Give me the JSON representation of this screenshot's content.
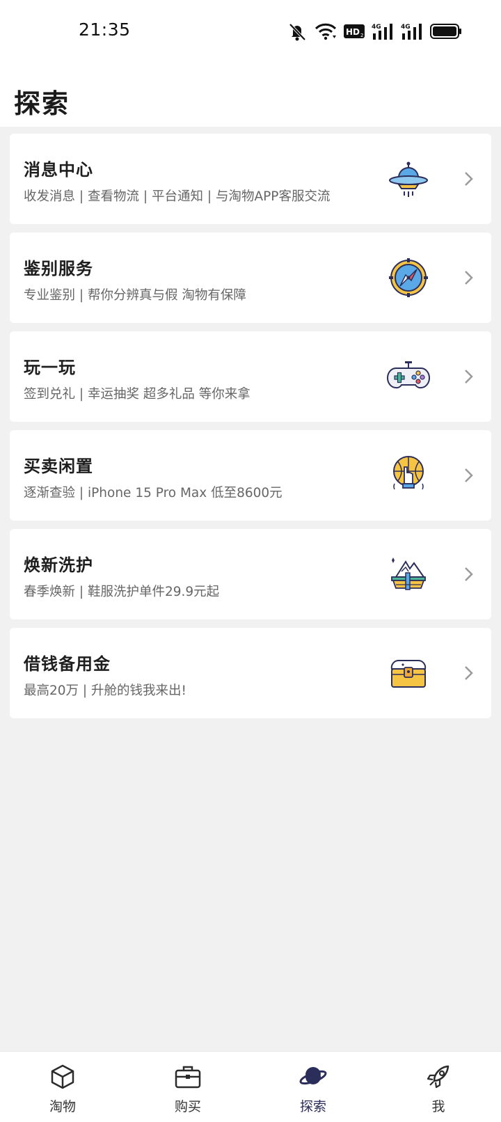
{
  "status_bar": {
    "time": "21:35",
    "icons": [
      "bell-muted-icon",
      "wifi-icon",
      "hd-icon",
      "signal-4g-icon",
      "signal-4g-icon",
      "battery-icon"
    ]
  },
  "header": {
    "title": "探索"
  },
  "cards": [
    {
      "title": "消息中心",
      "subtitle": "收发消息 | 查看物流 | 平台通知 | 与淘物APP客服交流",
      "icon": "ufo-icon"
    },
    {
      "title": "鉴别服务",
      "subtitle": "专业鉴别 | 帮你分辨真与假 淘物有保障",
      "icon": "compass-icon"
    },
    {
      "title": "玩一玩",
      "subtitle": "签到兑礼 | 幸运抽奖 超多礼品 等你来拿",
      "icon": "gamepad-icon"
    },
    {
      "title": "买卖闲置",
      "subtitle": "逐渐查验 | iPhone 15 Pro Max 低至8600元",
      "icon": "basketball-hand-icon"
    },
    {
      "title": "焕新洗护",
      "subtitle": "春季焕新 | 鞋服洗护单件29.9元起",
      "icon": "mountain-island-icon"
    },
    {
      "title": "借钱备用金",
      "subtitle": "最高20万 | 升舱的钱我来出!",
      "icon": "treasure-chest-icon"
    }
  ],
  "bottom_nav": [
    {
      "label": "淘物",
      "icon": "cube-icon",
      "active": false
    },
    {
      "label": "购买",
      "icon": "briefcase-icon",
      "active": false
    },
    {
      "label": "探索",
      "icon": "planet-icon",
      "active": true
    },
    {
      "label": "我",
      "icon": "rocket-icon",
      "active": false
    }
  ],
  "colors": {
    "background": "#f1f1f1",
    "card": "#ffffff",
    "active_nav": "#2b2d5a",
    "accent_yellow": "#f6c445",
    "accent_blue": "#5aa9e6"
  }
}
